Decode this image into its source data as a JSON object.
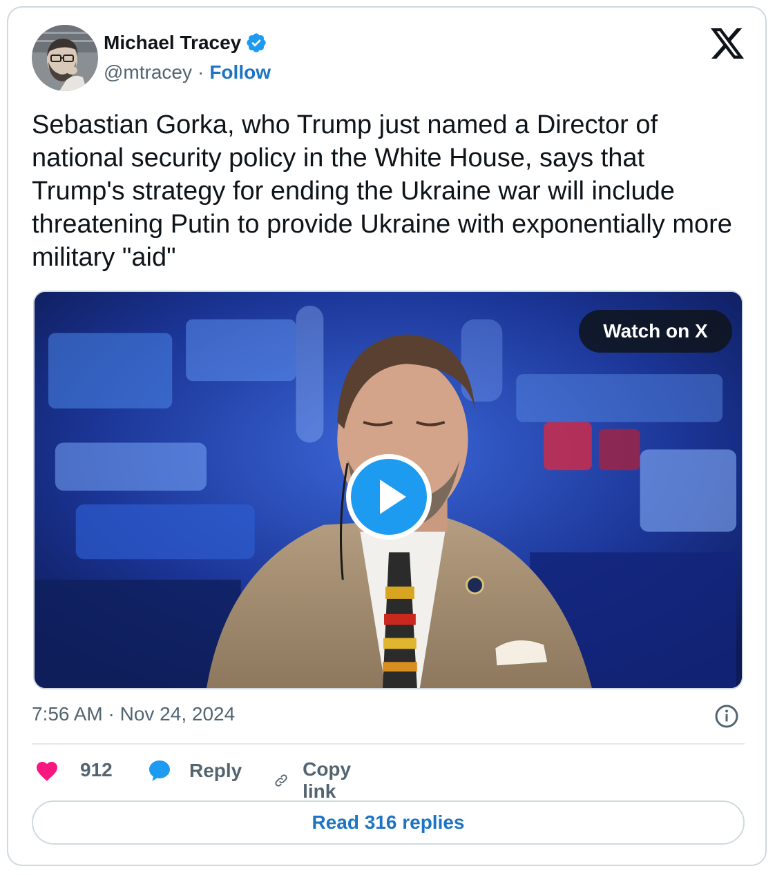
{
  "author": {
    "name": "Michael Tracey",
    "handle": "@mtracey",
    "separator": "·",
    "follow_label": "Follow"
  },
  "icons": {
    "verified": "verified-badge-icon",
    "brand": "x-logo-icon",
    "info": "info-icon",
    "like": "heart-icon",
    "reply": "speech-bubble-icon",
    "copy": "link-icon",
    "play": "play-icon"
  },
  "tweet": {
    "text": "Sebastian Gorka, who Trump just named a Director of national security policy in the White House, says that Trump's strategy for ending the Ukraine war will include threatening Putin to provide Ukraine with exponentially more military \"aid\""
  },
  "media": {
    "watch_label": "Watch on X"
  },
  "meta": {
    "timestamp": "7:56 AM · Nov 24, 2024"
  },
  "actions": {
    "likes": "912",
    "reply_label": "Reply",
    "copy_label": "Copy link"
  },
  "footer": {
    "read_replies_label": "Read 316 replies"
  },
  "colors": {
    "accent": "#1d74c4",
    "verified": "#1d9bf0",
    "like": "#f91880",
    "border": "#cfd9de",
    "muted": "#536471"
  }
}
